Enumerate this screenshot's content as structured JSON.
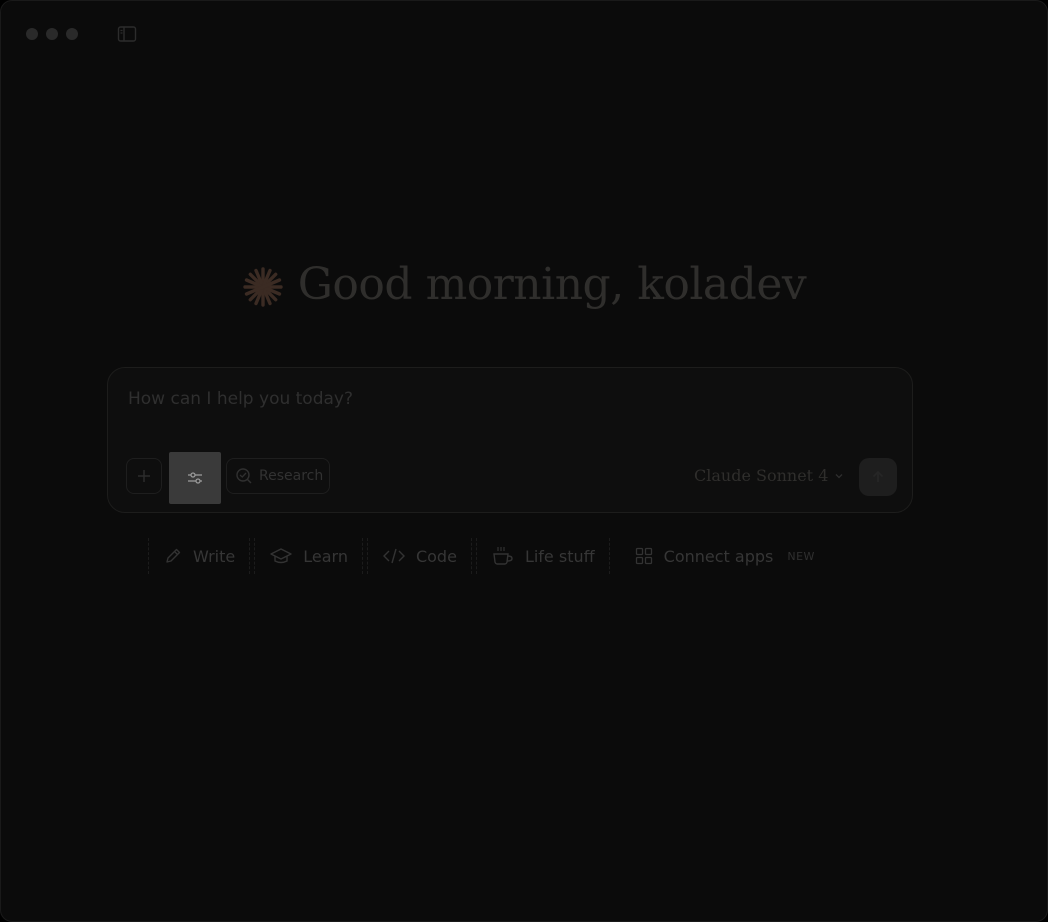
{
  "greeting": {
    "text": "Good morning, koladev"
  },
  "composer": {
    "placeholder": "How can I help you today?",
    "research_label": "Research",
    "model_label": "Claude Sonnet 4"
  },
  "suggestions": [
    {
      "label": "Write",
      "icon": "pencil-icon"
    },
    {
      "label": "Learn",
      "icon": "graduation-cap-icon"
    },
    {
      "label": "Code",
      "icon": "code-icon"
    },
    {
      "label": "Life stuff",
      "icon": "coffee-cup-icon"
    },
    {
      "label": "Connect apps",
      "icon": "grid-apps-icon",
      "badge": "NEW"
    }
  ],
  "colors": {
    "background": "#0b0b0b",
    "accent_spark": "#3a2a22"
  }
}
